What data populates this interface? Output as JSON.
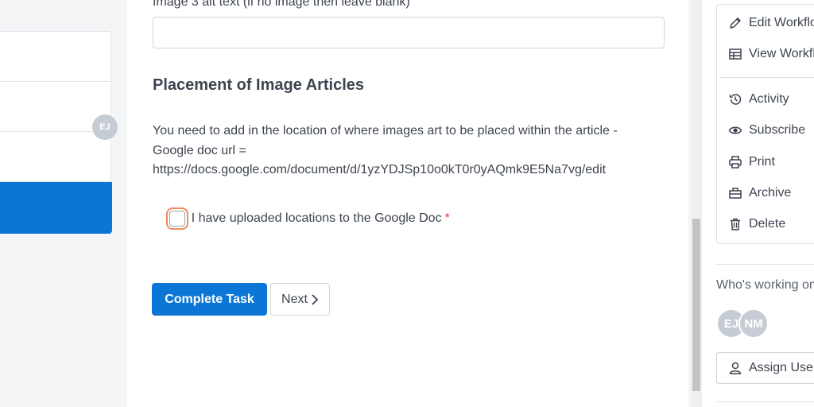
{
  "left": {
    "avatar_initials": "EJ"
  },
  "form": {
    "prev_field_label": "Image 3 alt text (if no image then leave blank)",
    "prev_field_value": "",
    "section_title": "Placement of Image Articles",
    "description_line1": "You need to add in the location of where images art to be placed within the article -",
    "description_line2": "Google doc url =",
    "description_line3": "https://docs.google.com/document/d/1yzYDJSp10o0kT0r0yAQmk9E5Na7vg/edit",
    "checkbox_number": "1",
    "checkbox_label": "I have uploaded locations to the Google Doc",
    "required_mark": "*",
    "complete_label": "Complete Task",
    "next_label": "Next"
  },
  "sidebar": {
    "menu": [
      {
        "label": "Edit Workflow",
        "icon": "pencil-icon"
      },
      {
        "label": "View Workflow",
        "icon": "table-icon"
      },
      {
        "label": "Activity",
        "icon": "history-icon"
      },
      {
        "label": "Subscribe",
        "icon": "eye-icon"
      },
      {
        "label": "Print",
        "icon": "printer-icon"
      },
      {
        "label": "Archive",
        "icon": "archive-icon"
      },
      {
        "label": "Delete",
        "icon": "trash-icon"
      }
    ],
    "working_label": "Who's working on this?",
    "avatars": [
      "EJ",
      "NM"
    ],
    "assign_label": "Assign Users"
  },
  "colors": {
    "primary": "#0b76d6",
    "focus_ring": "#f08a5d",
    "required": "#e0393e"
  }
}
